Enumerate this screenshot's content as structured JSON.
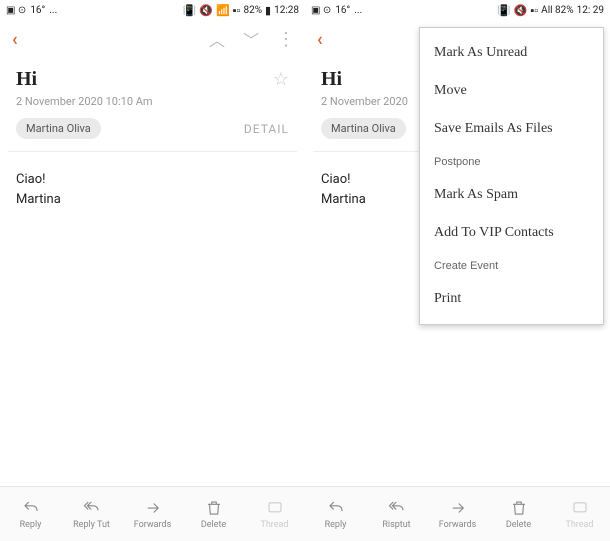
{
  "status": {
    "left_icons": "▣ ⊙",
    "temp": "16°",
    "ellipsis": "...",
    "right_text_1": "82%",
    "time_1": "12:28",
    "right_text_2": "All 82%",
    "time_2": "12: 29"
  },
  "email": {
    "subject": "Hi",
    "date_full": "2 November 2020 10:10 Am",
    "date_short": "2 November 2020",
    "sender": "Martina Oliva",
    "detail_label": "DETAIL",
    "greeting": "Ciao!",
    "signature": "Martina"
  },
  "menu": {
    "unread": "Mark As Unread",
    "move": "Move",
    "save": "Save Emails As Files",
    "postpone": "Postpone",
    "spam": "Mark As Spam",
    "vip": "Add To VIP Contacts",
    "create_event": "Create Event",
    "print": "Print"
  },
  "actions": {
    "reply": "Reply",
    "reply_tut": "Reply Tut",
    "forwards": "Forwards",
    "delete": "Delete",
    "thread": "Thread",
    "risptut": "Risptut"
  }
}
